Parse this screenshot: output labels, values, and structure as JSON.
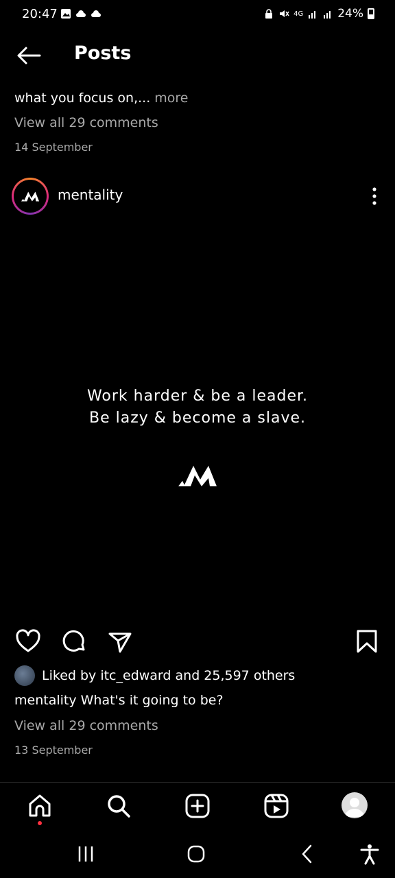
{
  "status_bar": {
    "time": "20:47",
    "network": "4G",
    "battery": "24%",
    "icons": [
      "gallery-icon",
      "cloud-icon",
      "cloud-icon",
      "lock-icon",
      "mute-icon",
      "signal-icon",
      "signal-icon",
      "battery-icon"
    ]
  },
  "header": {
    "title": "Posts"
  },
  "previous_post": {
    "caption": "what you focus on,...",
    "more": "more",
    "view_comments": "View all 29 comments",
    "date": "14 September"
  },
  "post": {
    "username": "mentality",
    "quote_line1": "Work harder & be a leader.",
    "quote_line2": "Be lazy & become a slave.",
    "liked_by": "Liked by itc_edward and 25,597 others",
    "caption": "mentality What's it going to be?",
    "view_comments": "View all 29 comments",
    "date": "13 September"
  },
  "bottom_nav": [
    "home-icon",
    "search-icon",
    "create-icon",
    "reels-icon",
    "profile-icon"
  ],
  "colors": {
    "background": "#000000",
    "secondary_text": "#a8a8a8",
    "notification_dot": "#ff3040"
  }
}
